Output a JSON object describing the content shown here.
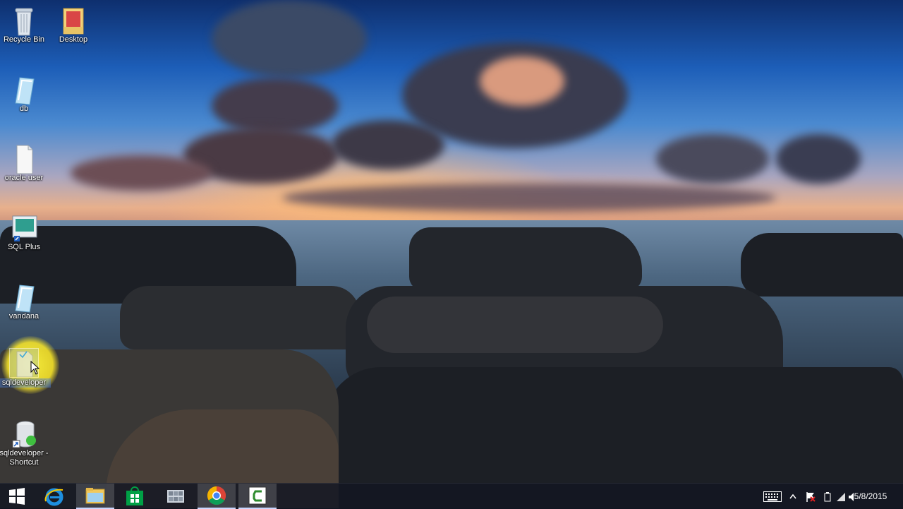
{
  "desktop": {
    "icons": [
      {
        "label": "Recycle Bin",
        "icon": "recycle-bin-icon"
      },
      {
        "label": "Desktop",
        "icon": "folder-icon"
      },
      {
        "label": "db",
        "icon": "file-icon"
      },
      {
        "label": "oracle user",
        "icon": "text-file-icon"
      },
      {
        "label": "SQL Plus",
        "icon": "sqlplus-icon"
      },
      {
        "label": "vandana",
        "icon": "file-icon"
      },
      {
        "label": "sqldeveloper",
        "icon": "sqldeveloper-icon"
      },
      {
        "label": "sqldeveloper - Shortcut",
        "icon": "shortcut-icon"
      }
    ]
  },
  "taskbar": {
    "pinned": [
      {
        "name": "start",
        "icon": "windows-logo-icon"
      },
      {
        "name": "internet-explorer",
        "icon": "internet-explorer-icon"
      },
      {
        "name": "file-explorer",
        "icon": "folder-icon"
      },
      {
        "name": "store",
        "icon": "store-icon"
      },
      {
        "name": "apps",
        "icon": "grid-icon"
      },
      {
        "name": "chrome",
        "icon": "chrome-icon"
      },
      {
        "name": "camtasia",
        "icon": "camtasia-icon"
      }
    ],
    "tray": {
      "keyboard_icon": "keyboard-icon",
      "up_arrow_icon": "up-arrow-icon",
      "flag_icon": "action-center-flag-icon",
      "battery_icon": "battery-icon",
      "network_icon": "network-icon",
      "volume_icon": "volume-icon"
    },
    "clock": {
      "date": "5/8/2015"
    }
  },
  "colors": {
    "taskbar_bg": "#121622",
    "highlight": "#ffee33",
    "ie_blue": "#1e8fe0",
    "store_green": "#00a046"
  }
}
